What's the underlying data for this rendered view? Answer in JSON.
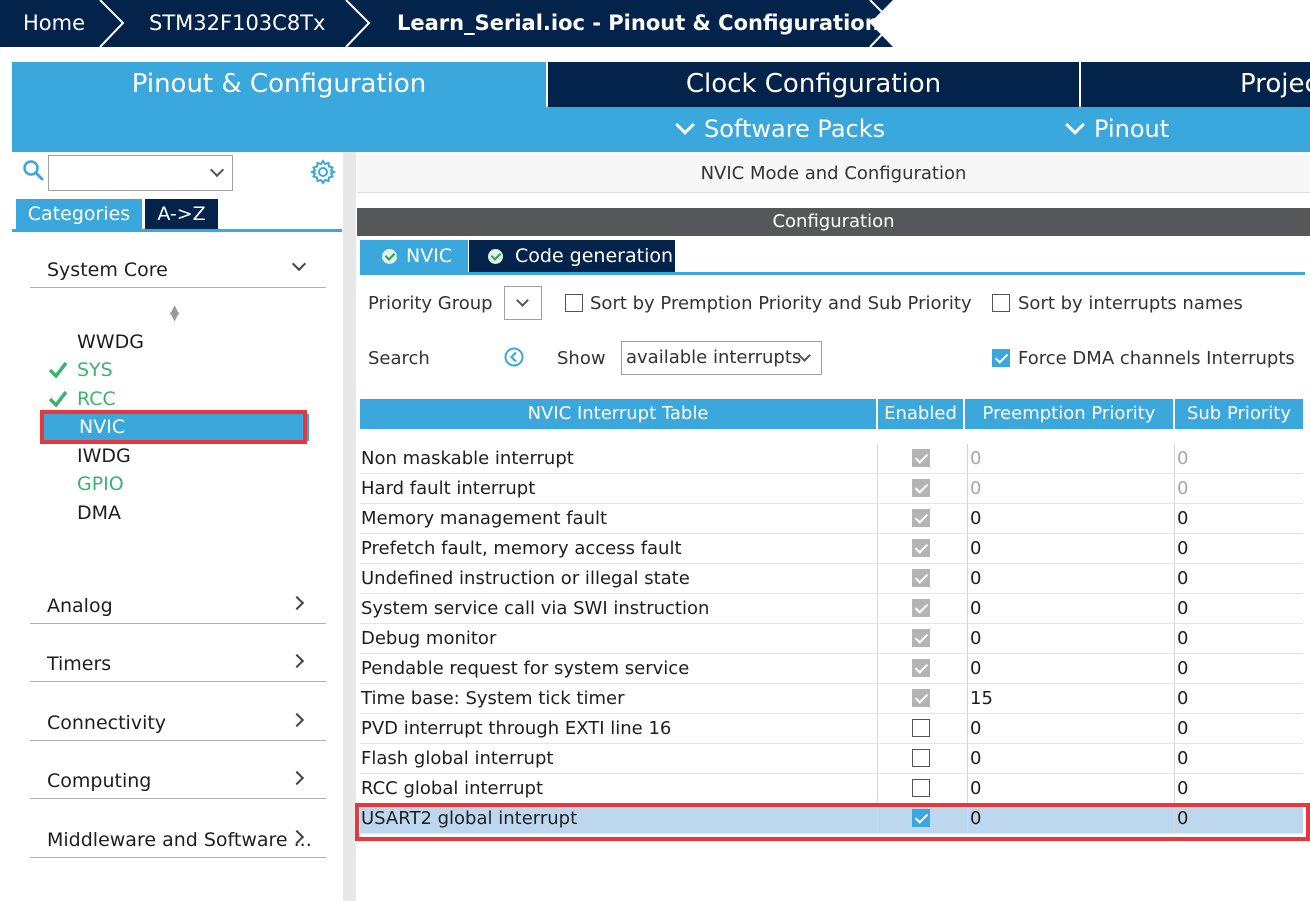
{
  "breadcrumb": {
    "home": "Home",
    "device": "STM32F103C8Tx",
    "current": "Learn_Serial.ioc - Pinout & Configuration"
  },
  "main_tabs": [
    {
      "label": "Pinout & Configuration",
      "active": true
    },
    {
      "label": "Clock Configuration",
      "active": false
    },
    {
      "label": "Project Manager",
      "active": false
    }
  ],
  "sub_menu": {
    "software_packs": "Software Packs",
    "pinout": "Pinout"
  },
  "left_panel": {
    "search_value": "",
    "tabs": {
      "categories": "Categories",
      "atoz": "A->Z"
    },
    "system_core": {
      "title": "System Core",
      "items": [
        {
          "label": "WWDG",
          "status": "none"
        },
        {
          "label": "SYS",
          "status": "configured"
        },
        {
          "label": "RCC",
          "status": "configured"
        },
        {
          "label": "NVIC",
          "status": "selected"
        },
        {
          "label": "IWDG",
          "status": "none"
        },
        {
          "label": "GPIO",
          "status": "active"
        },
        {
          "label": "DMA",
          "status": "none"
        }
      ]
    },
    "categories": [
      "Analog",
      "Timers",
      "Connectivity",
      "Computing",
      "Middleware and Software ..."
    ]
  },
  "right_panel": {
    "mode_title": "NVIC Mode and Configuration",
    "config_title": "Configuration",
    "tabs": [
      "NVIC",
      "Code generation"
    ],
    "controls": {
      "priority_group_label": "Priority Group",
      "priority_group_value": "",
      "sort_preemption_label": "Sort by Premption Priority and Sub Priority",
      "sort_preemption_checked": false,
      "sort_names_label": "Sort by interrupts names",
      "sort_names_checked": false,
      "search_label": "Search",
      "show_label": "Show",
      "show_value": "available interrupts",
      "force_dma_label": "Force DMA channels Interrupts",
      "force_dma_checked": true
    },
    "table": {
      "headers": [
        "NVIC Interrupt Table",
        "Enabled",
        "Preemption Priority",
        "Sub Priority"
      ],
      "rows": [
        {
          "name": "Non maskable interrupt",
          "enabled": "locked",
          "preemption": "0",
          "sub": "0",
          "dim": true
        },
        {
          "name": "Hard fault interrupt",
          "enabled": "locked",
          "preemption": "0",
          "sub": "0",
          "dim": true
        },
        {
          "name": "Memory management fault",
          "enabled": "locked",
          "preemption": "0",
          "sub": "0",
          "dim": false
        },
        {
          "name": "Prefetch fault, memory access fault",
          "enabled": "locked",
          "preemption": "0",
          "sub": "0",
          "dim": false
        },
        {
          "name": "Undefined instruction or illegal state",
          "enabled": "locked",
          "preemption": "0",
          "sub": "0",
          "dim": false
        },
        {
          "name": "System service call via SWI instruction",
          "enabled": "locked",
          "preemption": "0",
          "sub": "0",
          "dim": false
        },
        {
          "name": "Debug monitor",
          "enabled": "locked",
          "preemption": "0",
          "sub": "0",
          "dim": false
        },
        {
          "name": "Pendable request for system service",
          "enabled": "locked",
          "preemption": "0",
          "sub": "0",
          "dim": false
        },
        {
          "name": "Time base: System tick timer",
          "enabled": "locked",
          "preemption": "15",
          "sub": "0",
          "dim": false
        },
        {
          "name": "PVD interrupt through EXTI line 16",
          "enabled": "off",
          "preemption": "0",
          "sub": "0",
          "dim": false
        },
        {
          "name": "Flash global interrupt",
          "enabled": "off",
          "preemption": "0",
          "sub": "0",
          "dim": false
        },
        {
          "name": "RCC global interrupt",
          "enabled": "off",
          "preemption": "0",
          "sub": "0",
          "dim": false
        },
        {
          "name": "USART2 global interrupt",
          "enabled": "on",
          "preemption": "0",
          "sub": "0",
          "dim": false,
          "selected": true
        }
      ]
    }
  },
  "colors": {
    "navy": "#03234b",
    "accent_blue": "#3aa8dc",
    "highlight_red": "#e8363d",
    "ok_green": "#3cb371",
    "row_selected": "#bdd7ee"
  }
}
